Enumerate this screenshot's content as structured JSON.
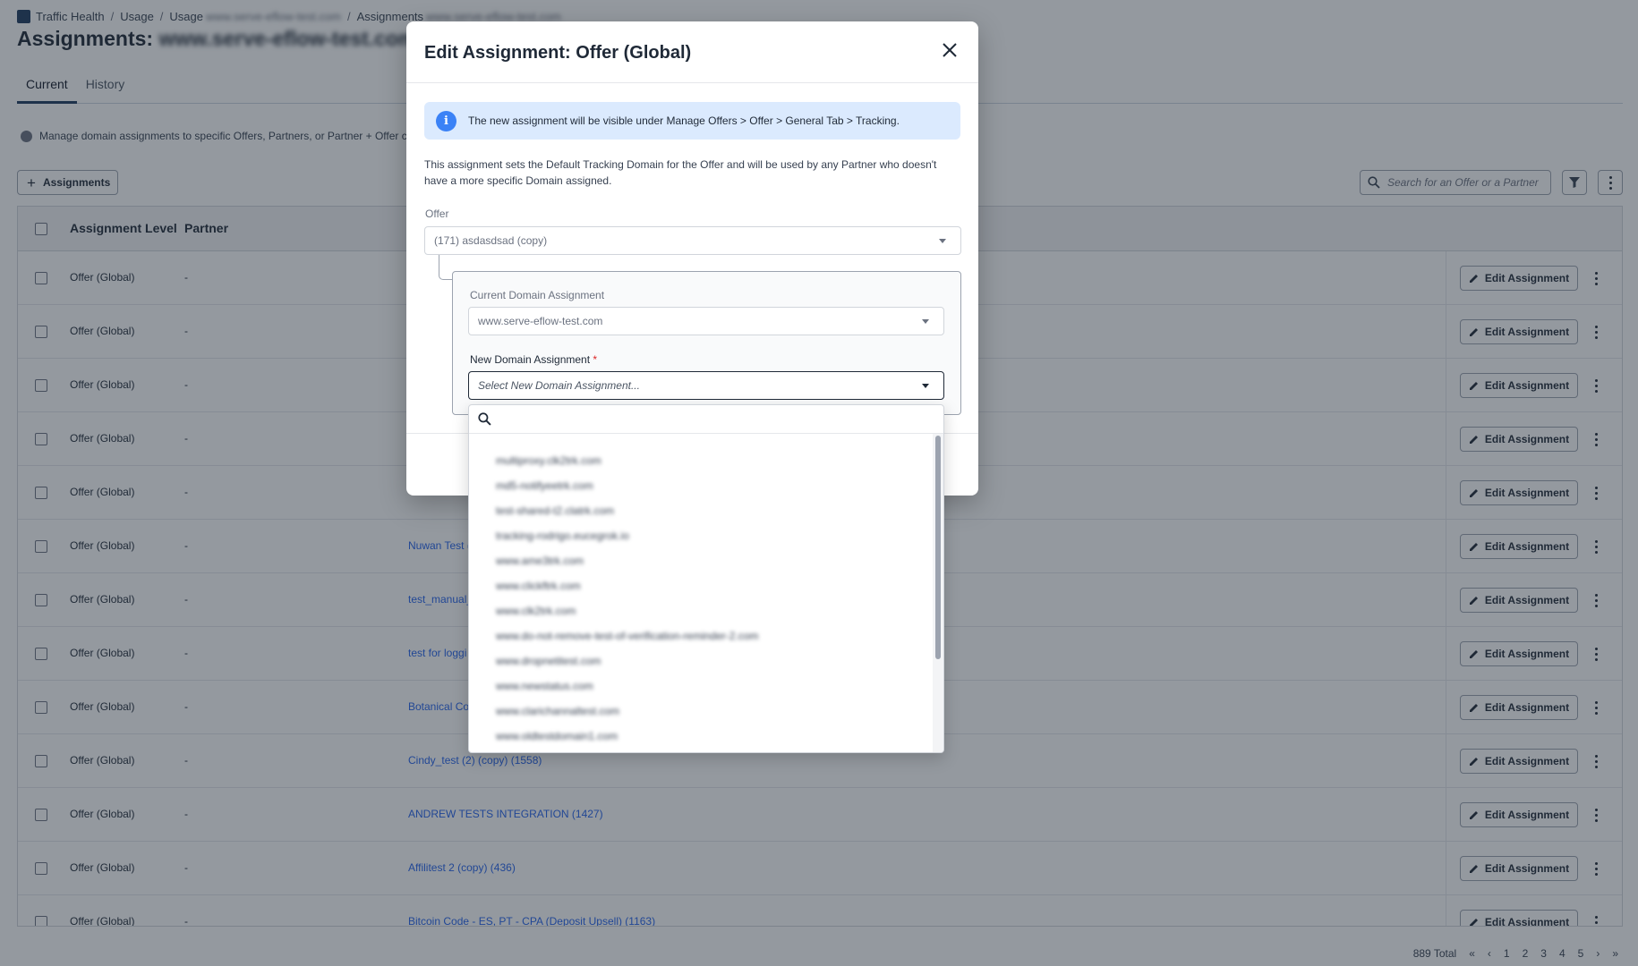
{
  "breadcrumb": {
    "items": [
      "Traffic Health",
      "Usage",
      "Usage",
      "Assignments"
    ],
    "blurred_1": "www.serve-eflow-test.com",
    "blurred_2": "www.serve-eflow-test.com"
  },
  "page": {
    "title_prefix": "Assignments:",
    "title_domain": "www.serve-eflow-test.com",
    "tabs": [
      "Current",
      "History"
    ],
    "info_note": "Manage domain assignments to specific Offers, Partners, or Partner + Offer co",
    "add_button": "Assignments",
    "search_placeholder": "Search for an Offer or a Partner"
  },
  "table": {
    "headers": {
      "level": "Assignment Level",
      "partner": "Partner"
    },
    "edit_label": "Edit Assignment",
    "rows": [
      {
        "level": "Offer (Global)",
        "partner": "-",
        "offer": ""
      },
      {
        "level": "Offer (Global)",
        "partner": "-",
        "offer": ""
      },
      {
        "level": "Offer (Global)",
        "partner": "-",
        "offer": ""
      },
      {
        "level": "Offer (Global)",
        "partner": "-",
        "offer": ""
      },
      {
        "level": "Offer (Global)",
        "partner": "-",
        "offer": ""
      },
      {
        "level": "Offer (Global)",
        "partner": "-",
        "offer": "Nuwan Test ("
      },
      {
        "level": "Offer (Global)",
        "partner": "-",
        "offer": "test_manual_"
      },
      {
        "level": "Offer (Global)",
        "partner": "-",
        "offer": "test for loggi"
      },
      {
        "level": "Offer (Global)",
        "partner": "-",
        "offer": "Botanical Co"
      },
      {
        "level": "Offer (Global)",
        "partner": "-",
        "offer": "Cindy_test (2) (copy) (1558)"
      },
      {
        "level": "Offer (Global)",
        "partner": "-",
        "offer": "ANDREW TESTS INTEGRATION (1427)"
      },
      {
        "level": "Offer (Global)",
        "partner": "-",
        "offer": "Affilitest 2 (copy) (436)"
      },
      {
        "level": "Offer (Global)",
        "partner": "-",
        "offer": "Bitcoin Code - ES, PT - CPA (Deposit Upsell) (1163)"
      }
    ]
  },
  "pagination": {
    "total": "889 Total",
    "pages": [
      "1",
      "2",
      "3",
      "4",
      "5"
    ]
  },
  "modal": {
    "title": "Edit Assignment: Offer (Global)",
    "banner": "The new assignment will be visible under Manage Offers > Offer > General Tab > Tracking.",
    "description": "This assignment sets the Default Tracking Domain for the Offer and will be used by any Partner who doesn't have a more specific Domain assigned.",
    "offer_label": "Offer",
    "offer_value": "(171) asdasdsad (copy)",
    "current_label": "Current Domain Assignment",
    "current_value": "www.serve-eflow-test.com",
    "new_label": "New Domain Assignment",
    "required_mark": "*",
    "new_placeholder": "Select New Domain Assignment..."
  },
  "dropdown": {
    "options": [
      "multiproxy.clk2trk.com",
      "md5-notifyeetrk.com",
      "test-shared-t2.clatrk.com",
      "tracking-rodrigo.eucegrok.io",
      "www.ame3trk.com",
      "www.clickftrk.com",
      "www.clk2trk.com",
      "www.do-not-remove-test-of-verification-reminder-2.com",
      "www.dropnetitest.com",
      "www.newstatus.com",
      "www.clarichannaltest.com",
      "www.oldtestdomain1.com"
    ]
  },
  "colors": {
    "accent": "#1e3a5f",
    "link": "#2563eb",
    "info_bg": "#dbeafe",
    "info_icon": "#3b82f6",
    "required": "#dc2626"
  }
}
